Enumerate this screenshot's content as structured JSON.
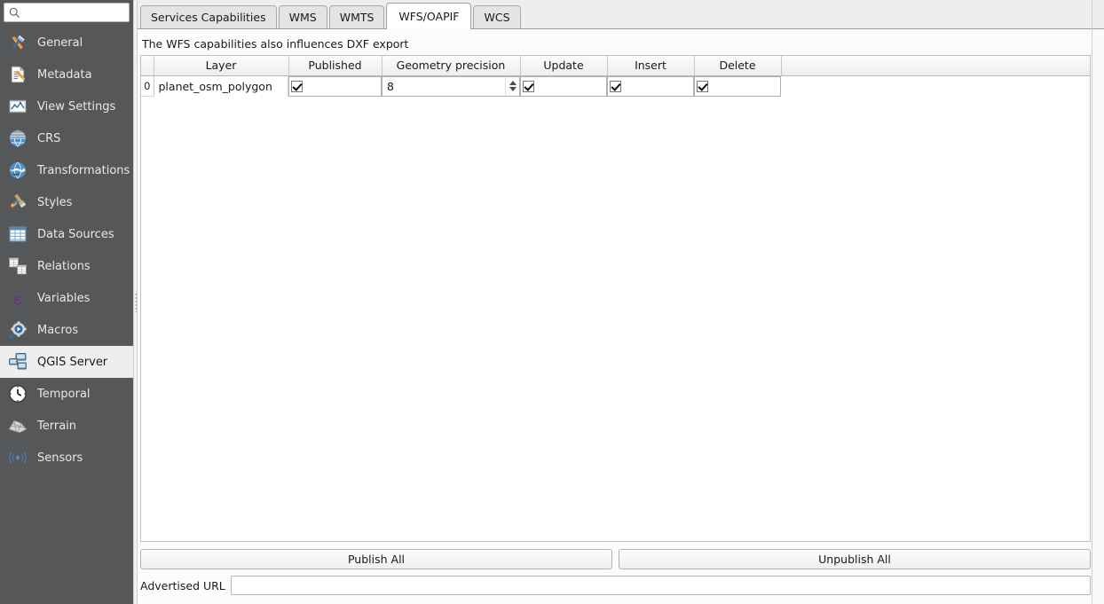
{
  "search": {
    "placeholder": "",
    "value": "",
    "icon": "search-icon"
  },
  "sidebar": {
    "items": [
      {
        "label": "General",
        "icon": "hammer-wrench-icon",
        "selected": false
      },
      {
        "label": "Metadata",
        "icon": "document-pencil-icon",
        "selected": false
      },
      {
        "label": "View Settings",
        "icon": "map-view-icon",
        "selected": false
      },
      {
        "label": "CRS",
        "icon": "globe-grid-icon",
        "selected": false
      },
      {
        "label": "Transformations",
        "icon": "globe-arrows-icon",
        "selected": false
      },
      {
        "label": "Styles",
        "icon": "paintbrush-icon",
        "selected": false
      },
      {
        "label": "Data Sources",
        "icon": "table-icon",
        "selected": false
      },
      {
        "label": "Relations",
        "icon": "two-tables-icon",
        "selected": false
      },
      {
        "label": "Variables",
        "icon": "epsilon-icon",
        "selected": false
      },
      {
        "label": "Macros",
        "icon": "gear-play-icon",
        "selected": false
      },
      {
        "label": "QGIS Server",
        "icon": "servers-icon",
        "selected": true
      },
      {
        "label": "Temporal",
        "icon": "clock-icon",
        "selected": false
      },
      {
        "label": "Terrain",
        "icon": "terrain-mesh-icon",
        "selected": false
      },
      {
        "label": "Sensors",
        "icon": "sensor-waves-icon",
        "selected": false
      }
    ]
  },
  "tabs": [
    {
      "label": "Services Capabilities",
      "active": false
    },
    {
      "label": "WMS",
      "active": false
    },
    {
      "label": "WMTS",
      "active": false
    },
    {
      "label": "WFS/OAPIF",
      "active": true
    },
    {
      "label": "WCS",
      "active": false
    }
  ],
  "pane": {
    "hint": "The WFS capabilities also influences DXF export",
    "table": {
      "columns": [
        "Layer",
        "Published",
        "Geometry precision",
        "Update",
        "Insert",
        "Delete"
      ],
      "rows": [
        {
          "index": "0",
          "layer": "planet_osm_polygon",
          "published": true,
          "geometry_precision": "8",
          "update": true,
          "insert": true,
          "delete": true
        }
      ]
    },
    "buttons": {
      "publish_all": "Publish All",
      "unpublish_all": "Unpublish All"
    },
    "advertised_url": {
      "label": "Advertised URL",
      "value": "",
      "placeholder": ""
    }
  },
  "colors": {
    "sidebar_bg": "#555759",
    "sidebar_selected_bg": "#eeeeee",
    "tabbar_bg": "#eeeeee",
    "active_tab_bg": "#ffffff",
    "pane_bg": "#fcfcfc",
    "table_bg": "#ffffff",
    "border": "#bfbfbf"
  }
}
